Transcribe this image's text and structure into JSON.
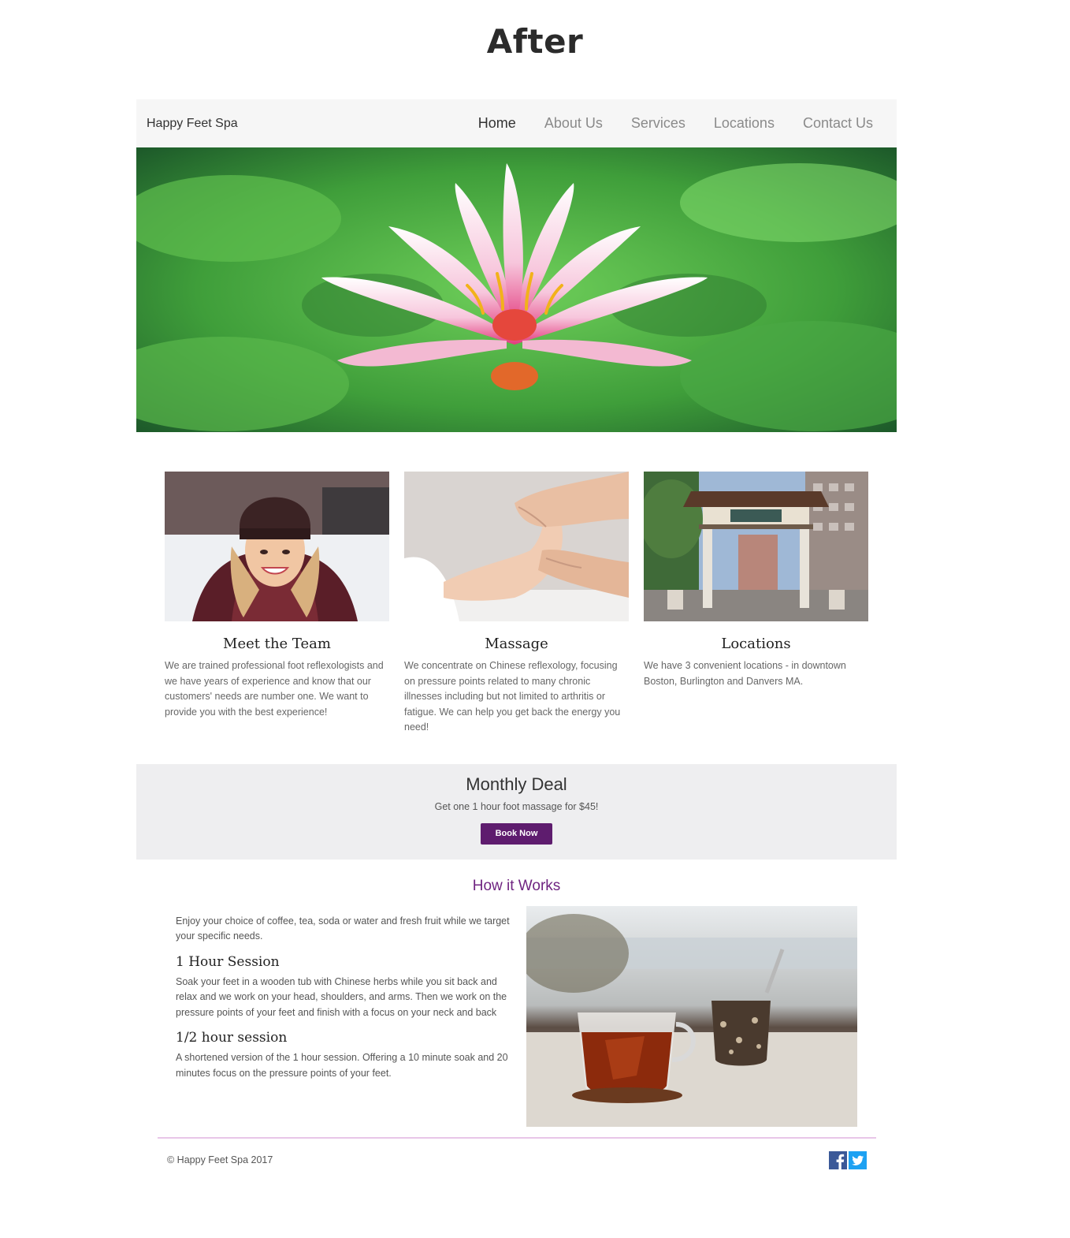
{
  "page_heading": "After",
  "nav": {
    "brand": "Happy Feet Spa",
    "links": [
      "Home",
      "About Us",
      "Services",
      "Locations",
      "Contact Us"
    ],
    "active": "Home"
  },
  "hero": {
    "icon": "lotus-flower-image"
  },
  "cards": [
    {
      "image": "woman-smiling-photo",
      "title": "Meet the Team",
      "text": "We are trained professional foot reflexologists and we have years of experience and know that our customers' needs are number one. We want to provide you with the best experience!"
    },
    {
      "image": "foot-massage-photo",
      "title": "Massage",
      "text": "We concentrate on Chinese reflexology, focusing on pressure points related to many chronic illnesses including but not limited to arthritis or fatigue. We can help you get back the energy you need!"
    },
    {
      "image": "chinatown-gate-photo",
      "title": "Locations",
      "text": "We have 3 convenient locations - in downtown Boston, Burlington and Danvers MA."
    }
  ],
  "deal": {
    "title": "Monthly Deal",
    "text": "Get one 1 hour foot massage for $45!",
    "button": "Book Now"
  },
  "how": {
    "title": "How it Works",
    "intro": "Enjoy your choice of coffee, tea, soda or water and fresh fruit while we target your specific needs.",
    "session1_title": "1 Hour Session",
    "session1_text": "Soak your feet in a wooden tub with Chinese herbs while you sit back and relax and we work on your head, shoulders, and arms. Then we work on the pressure points of your feet and finish with a focus on your neck and back",
    "session2_title": "1/2 hour session",
    "session2_text": "A shortened version of the 1 hour session. Offering a 10 minute soak and 20 minutes focus on the pressure points of your feet.",
    "image": "tea-cup-photo"
  },
  "footer": {
    "copyright": "© Happy Feet Spa 2017",
    "social": [
      "facebook-icon",
      "twitter-icon"
    ]
  },
  "colors": {
    "accent": "#5e1c6e",
    "how_title": "#6f2481",
    "footer_line": "#e8c6e8",
    "nav_bg": "#f6f6f6",
    "deal_bg": "#eeeef0",
    "facebook": "#3b5998",
    "twitter": "#1da1f2"
  }
}
